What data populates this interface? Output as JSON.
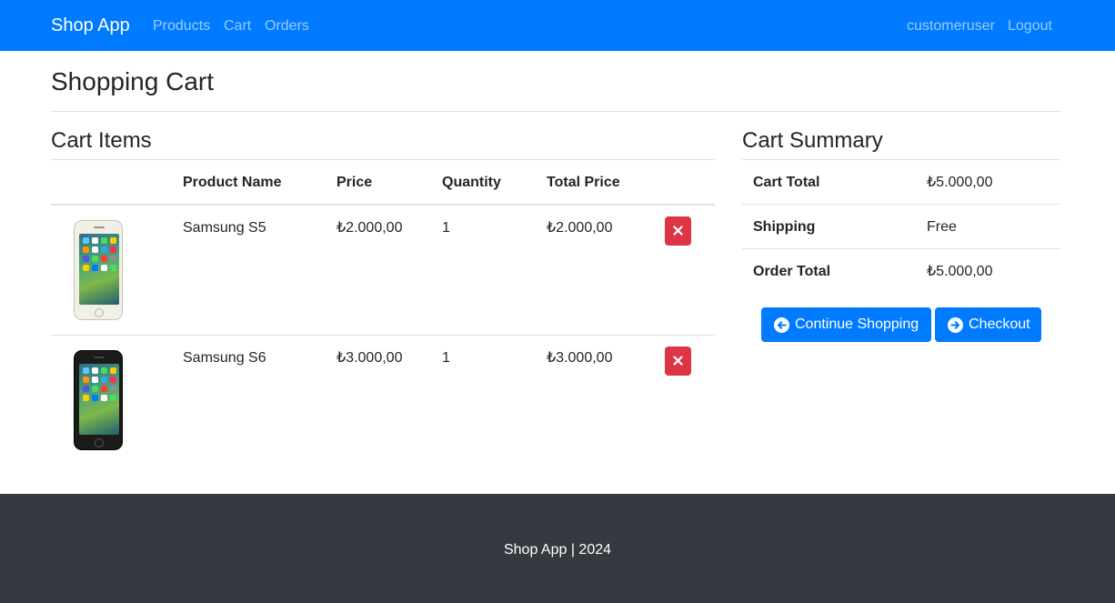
{
  "navbar": {
    "brand": "Shop App",
    "links": [
      "Products",
      "Cart",
      "Orders"
    ],
    "user": "customeruser",
    "logout": "Logout"
  },
  "page": {
    "title": "Shopping Cart"
  },
  "cart_items": {
    "title": "Cart Items",
    "headers": [
      "",
      "Product Name",
      "Price",
      "Quantity",
      "Total Price",
      ""
    ],
    "rows": [
      {
        "image_icon": "white-smartphone-icon",
        "name": "Samsung S5",
        "price": "₺2.000,00",
        "quantity": "1",
        "total": "₺2.000,00"
      },
      {
        "image_icon": "black-smartphone-icon",
        "name": "Samsung S6",
        "price": "₺3.000,00",
        "quantity": "1",
        "total": "₺3.000,00"
      }
    ]
  },
  "summary": {
    "title": "Cart Summary",
    "rows": [
      {
        "label": "Cart Total",
        "value": "₺5.000,00"
      },
      {
        "label": "Shipping",
        "value": "Free"
      },
      {
        "label": "Order Total",
        "value": "₺5.000,00"
      }
    ],
    "continue_label": "Continue Shopping",
    "checkout_label": "Checkout"
  },
  "footer": {
    "text": "Shop App | 2024"
  },
  "colors": {
    "primary": "#007bff",
    "danger": "#dc3545",
    "footer": "#343a40",
    "text": "#212529",
    "border": "#dee2e6"
  }
}
